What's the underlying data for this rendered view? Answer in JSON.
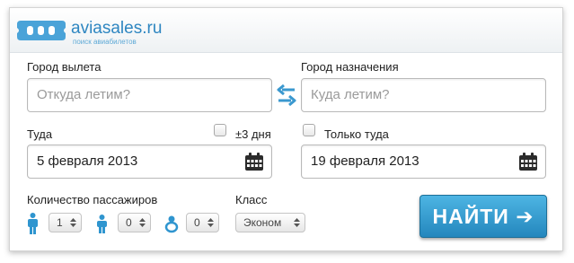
{
  "brand": {
    "name": "aviasales.ru",
    "tagline": "поиск авиабилетов",
    "color": "#2e86c1"
  },
  "origin": {
    "label": "Город вылета",
    "placeholder": "Откуда летим?"
  },
  "destination": {
    "label": "Город назначения",
    "placeholder": "Куда летим?"
  },
  "swap": {
    "icon": "swap-arrows-icon"
  },
  "depart": {
    "label": "Туда",
    "value": "5 февраля 2013",
    "flex_label": "±3 дня",
    "flex_checked": false,
    "icon": "calendar-icon"
  },
  "return": {
    "label": "Только туда",
    "value": "19 февраля 2013",
    "one_way_checked": false,
    "icon": "calendar-icon"
  },
  "passengers": {
    "label": "Количество пассажиров",
    "adults": "1",
    "children": "0",
    "infants": "0"
  },
  "cabin": {
    "label": "Класс",
    "value": "Эконом"
  },
  "search": {
    "label": "НАЙТИ ➔",
    "color": "#2e9ad4"
  }
}
